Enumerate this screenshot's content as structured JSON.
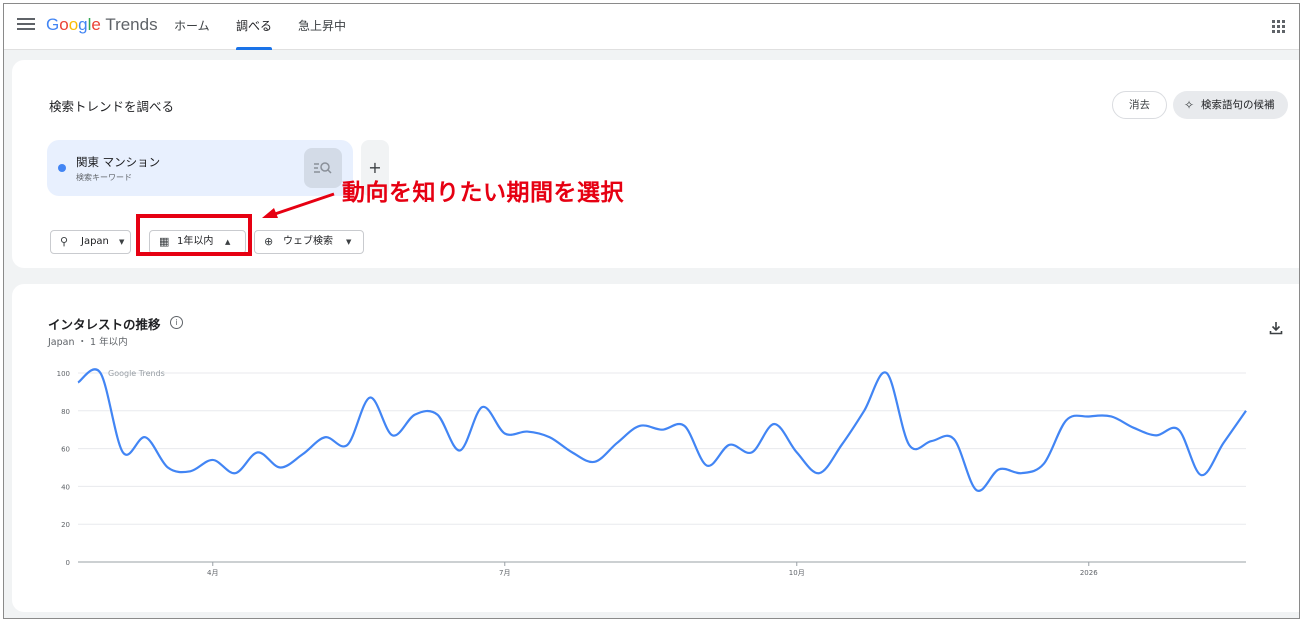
{
  "header": {
    "logo": {
      "letters": [
        "G",
        "o",
        "o",
        "g",
        "l",
        "e"
      ],
      "suffix": "Trends"
    },
    "nav_tabs": [
      {
        "label": "ホーム",
        "active": false
      },
      {
        "label": "調べる",
        "active": true
      },
      {
        "label": "急上昇中",
        "active": false
      }
    ]
  },
  "explore": {
    "title": "検索トレンドを調べる",
    "clear_label": "消去",
    "suggest_label": "検索語句の候補",
    "term": {
      "label": "関東 マンション",
      "sub": "検索キーワード",
      "color": "#4285f4"
    },
    "add_label": "+",
    "filters": {
      "region": "Japan",
      "period": "1年以内",
      "property": "ウェブ検索"
    }
  },
  "annotation": {
    "text": "動向を知りたい期間を選択",
    "color": "#e60012"
  },
  "chart": {
    "title": "インタレストの推移",
    "info_label": "i",
    "sub": "Japan ・ 1 年以内",
    "watermark": "Google Trends"
  },
  "chart_data": {
    "type": "line",
    "title": "インタレストの推移",
    "xlabel": "",
    "ylabel": "",
    "ylim": [
      0,
      100
    ],
    "yticks": [
      0,
      20,
      40,
      60,
      80,
      100
    ],
    "xtick_labels": [
      {
        "label": "4月",
        "x": 6
      },
      {
        "label": "7月",
        "x": 19
      },
      {
        "label": "10月",
        "x": 32
      },
      {
        "label": "2026",
        "x": 45
      }
    ],
    "grid": true,
    "line_color": "#4285f4",
    "series": [
      {
        "x": [
          0,
          1,
          2,
          3,
          4,
          5,
          6,
          7,
          8,
          9,
          10,
          11,
          12,
          13,
          14,
          15,
          16,
          17,
          18,
          19,
          20,
          21,
          22,
          23,
          24,
          25,
          26,
          27,
          28,
          29,
          30,
          31,
          32,
          33,
          34,
          35,
          36,
          37,
          38,
          39,
          40,
          41,
          42,
          43,
          44,
          45,
          46,
          47,
          48,
          49,
          50,
          51,
          52
        ],
        "values": [
          95,
          100,
          58,
          66,
          50,
          48,
          54,
          47,
          58,
          50,
          57,
          66,
          62,
          87,
          67,
          78,
          78,
          59,
          82,
          68,
          69,
          66,
          58,
          53,
          63,
          72,
          70,
          72,
          51,
          62,
          58,
          73,
          58,
          47,
          62,
          80,
          100,
          62,
          64,
          65,
          38,
          49,
          47,
          52,
          75,
          77,
          77,
          71,
          67,
          70,
          46,
          63,
          80
        ]
      }
    ]
  }
}
